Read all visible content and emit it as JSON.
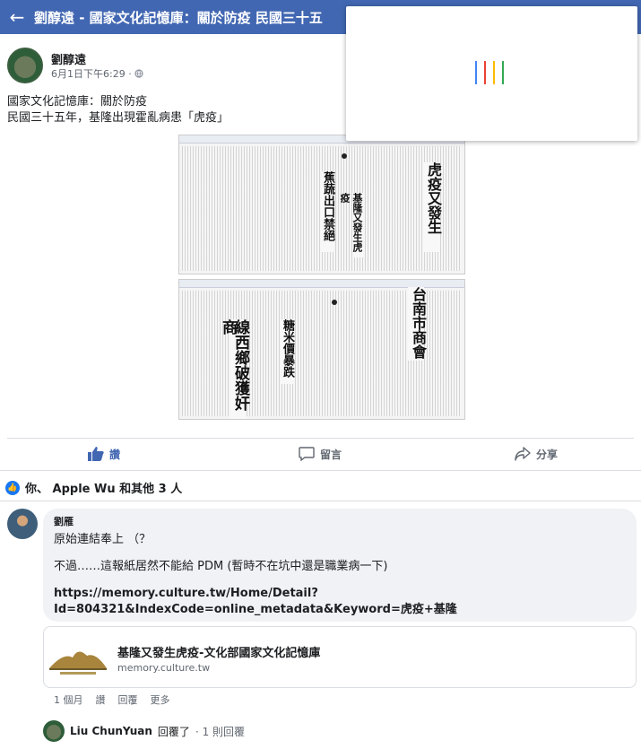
{
  "header": {
    "back_icon": "arrow-left-icon",
    "title": "劉醇遠 - 國家文化記憶庫：關於防疫 民國三十五"
  },
  "colors": {
    "brand": "#4267b2",
    "accent": "#1877f2",
    "loader": [
      "#4285f4",
      "#ea4335",
      "#fbbc05",
      "#34a853"
    ]
  },
  "post": {
    "author": "劉醇遠",
    "timestamp": "6月1日下午6:29 ·",
    "privacy_icon": "globe-icon",
    "text_line1": "國家文化記憶庫：關於防疫",
    "text_line2": "民國三十五年，基隆出現霍亂病患「虎疫」",
    "news1_headline1": "虎疫又發生",
    "news1_headline2": "基隆又發生虎疫",
    "news1_headline3": "蕉蔬出口禁絕",
    "news2_headline1": "台南市商會",
    "news2_headline2": "線西鄉破獲奸商",
    "news2_headline3": "糖米價暴跌"
  },
  "actions": {
    "like": "讚",
    "comment": "留言",
    "share": "分享"
  },
  "reactions": {
    "text": "你、 Apple Wu 和其他 3 人"
  },
  "comment": {
    "author": "劉雁",
    "line1": "原始連結奉上 （？",
    "line2": "不過……這報紙居然不能給 PDM (暫時不在坑中還是職業病一下)",
    "link": "https://memory.culture.tw/Home/Detail?Id=804321&IndexCode=online_metadata&Keyword=虎疫+基隆",
    "card_title": "基隆又發生虎疫-文化部國家文化記憶庫",
    "card_domain": "memory.culture.tw",
    "age": "1 個月",
    "like": "讚",
    "reply": "回覆",
    "more": "更多"
  },
  "reply": {
    "author": "Liu ChunYuan",
    "action": "回覆了",
    "count": "· 1 則回覆"
  }
}
